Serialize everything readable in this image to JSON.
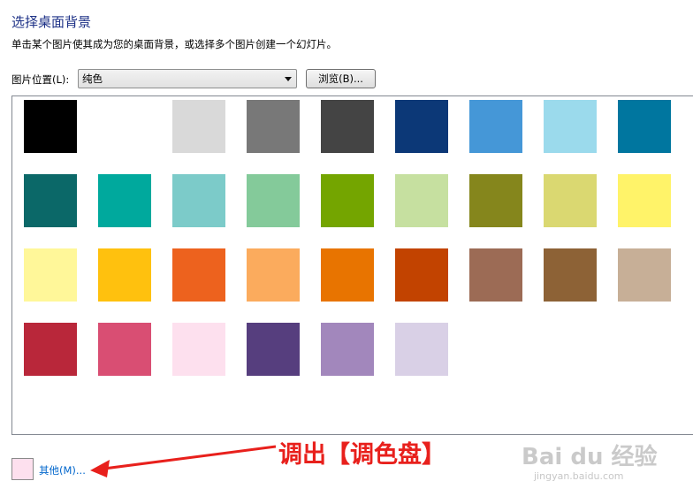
{
  "header": {
    "title": "选择桌面背景",
    "subtitle": "单击某个图片使其成为您的桌面背景，或选择多个图片创建一个幻灯片。"
  },
  "location": {
    "label": "图片位置(L):",
    "selected": "纯色",
    "browse_label": "浏览(B)..."
  },
  "swatches": [
    "#000000",
    "#ffffff",
    "#d9d9d9",
    "#787878",
    "#444444",
    "#0c3877",
    "#4597d7",
    "#9bdaec",
    "#00769f",
    "#0b6868",
    "#00a99d",
    "#7ccbc9",
    "#84ca9a",
    "#74a500",
    "#c6e0a0",
    "#85861c",
    "#dad871",
    "#fff369",
    "#fff799",
    "#ffc10e",
    "#ed621e",
    "#fbab5d",
    "#e87400",
    "#c24300",
    "#9c6b55",
    "#8d6236",
    "#c7af97",
    "#b9273a",
    "#d94e73",
    "#fde0ee",
    "#563e7e",
    "#a287bc",
    "#d9d0e6"
  ],
  "footer": {
    "preview_color": "#fde0ee",
    "more_label": "其他(M)..."
  },
  "annotation": {
    "text": "调出【调色盘】",
    "color": "#e8201c"
  },
  "watermark": {
    "logo": "Bai du 经验",
    "url": "jingyan.baidu.com"
  }
}
